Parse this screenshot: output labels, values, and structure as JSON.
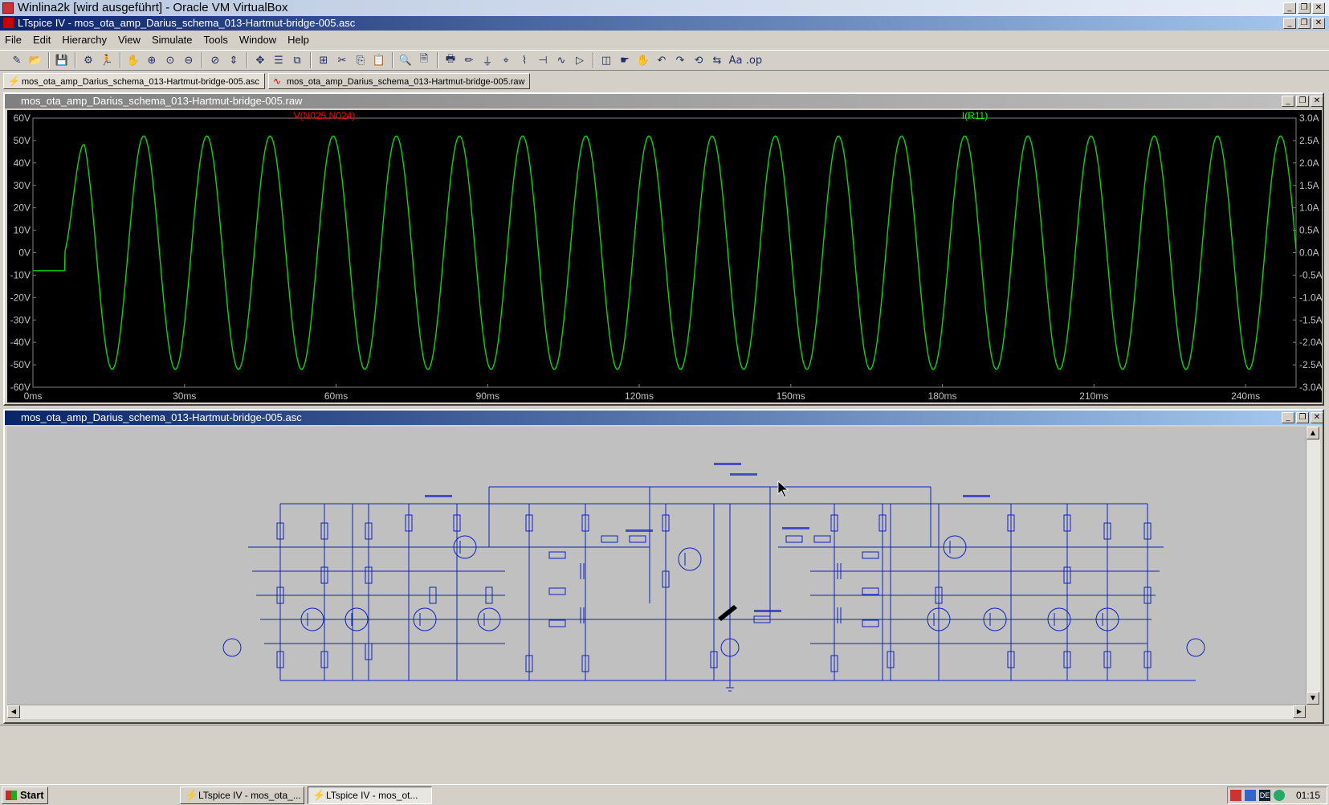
{
  "vbox": {
    "title": "Winlina2k [wird ausgeführt] - Oracle VM VirtualBox"
  },
  "app": {
    "title": "LTspice IV - mos_ota_amp_Darius_schema_013-Hartmut-bridge-005.asc"
  },
  "menu": [
    "File",
    "Edit",
    "Hierarchy",
    "View",
    "Simulate",
    "Tools",
    "Window",
    "Help"
  ],
  "toolbar_icons": [
    "new-schematic-icon",
    "open-icon",
    "save-icon",
    "control-panel-icon",
    "run-icon",
    "halt-icon",
    "zoom-in-icon",
    "zoom-area-icon",
    "zoom-out-icon",
    "zoom-fit-icon",
    "autorange-icon",
    "pan-icon",
    "tile-horizontal-icon",
    "tile-cascade-icon",
    "tile-vertical-icon",
    "cut-icon",
    "copy-icon",
    "paste-icon",
    "find-icon",
    "print-preview-icon",
    "print-icon",
    "draw-wire-icon",
    "ground-icon",
    "label-net-icon",
    "resistor-icon",
    "capacitor-icon",
    "inductor-icon",
    "diode-icon",
    "component-icon",
    "drag-icon",
    "move-icon",
    "undo-icon",
    "redo-icon",
    "rotate-icon",
    "mirror-icon",
    "text-icon",
    "spice-directive-icon"
  ],
  "tabs": [
    {
      "label": "mos_ota_amp_Darius_schema_013-Hartmut-bridge-005.asc",
      "icon": "schematic-icon"
    },
    {
      "label": "mos_ota_amp_Darius_schema_013-Hartmut-bridge-005.raw",
      "icon": "waveform-icon"
    }
  ],
  "waveform_panel": {
    "title": "mos_ota_amp_Darius_schema_013-Hartmut-bridge-005.raw"
  },
  "schematic_panel": {
    "title": "mos_ota_amp_Darius_schema_013-Hartmut-bridge-005.asc"
  },
  "chart_data": {
    "type": "line",
    "series": [
      {
        "name": "V(N025,N024)",
        "color": "#ff0000",
        "axis": "left"
      },
      {
        "name": "I(R11)",
        "color": "#00ff00",
        "axis": "right"
      }
    ],
    "waveform": {
      "settle_level": -0.4,
      "start_ms": 6.3,
      "frequency_hz": 80,
      "amplitude": 2.6,
      "offset": 0
    },
    "x_ticks": [
      "0ms",
      "30ms",
      "60ms",
      "90ms",
      "120ms",
      "150ms",
      "180ms",
      "210ms",
      "240ms"
    ],
    "xlim": [
      0,
      250
    ],
    "y_left_ticks": [
      "60V",
      "50V",
      "40V",
      "30V",
      "20V",
      "10V",
      "0V",
      "-10V",
      "-20V",
      "-30V",
      "-40V",
      "-50V",
      "-60V"
    ],
    "ylim_left": [
      -60,
      60
    ],
    "y_right_ticks": [
      "3.0A",
      "2.5A",
      "2.0A",
      "1.5A",
      "1.0A",
      "0.5A",
      "0.0A",
      "-0.5A",
      "-1.0A",
      "-1.5A",
      "-2.0A",
      "-2.5A",
      "-3.0A"
    ],
    "ylim_right": [
      -3.0,
      3.0
    ],
    "grid": false
  },
  "taskbar": {
    "start": "Start",
    "tasks": [
      "LTspice IV - mos_ota_...",
      "LTspice IV - mos_ot..."
    ],
    "clock": "01:15"
  }
}
